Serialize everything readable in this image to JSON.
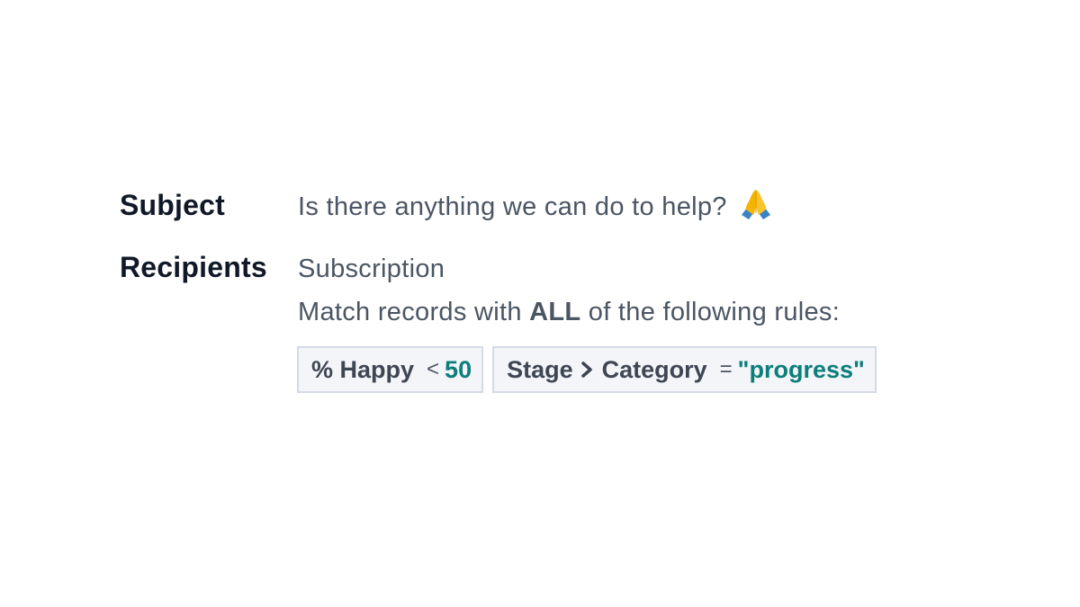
{
  "subject": {
    "label": "Subject",
    "value": "Is there anything we can do to help?",
    "emoji_icon": "folded-hands-emoji"
  },
  "recipients": {
    "label": "Recipients",
    "value": "Subscription",
    "match_prefix": "Match records with ",
    "match_keyword": "ALL",
    "match_suffix": " of the following rules:"
  },
  "rules": [
    {
      "field": "% Happy",
      "operator": "<",
      "value": "50"
    },
    {
      "field_parent": "Stage",
      "separator_icon": "chevron-right-icon",
      "field_child": "Category",
      "operator": "=",
      "value": "\"progress\""
    }
  ],
  "colors": {
    "label": "#111827",
    "text": "#4b5563",
    "rule_bg": "#f3f5f9",
    "rule_border": "#d5dae6",
    "rule_value": "#0d7f7a"
  }
}
